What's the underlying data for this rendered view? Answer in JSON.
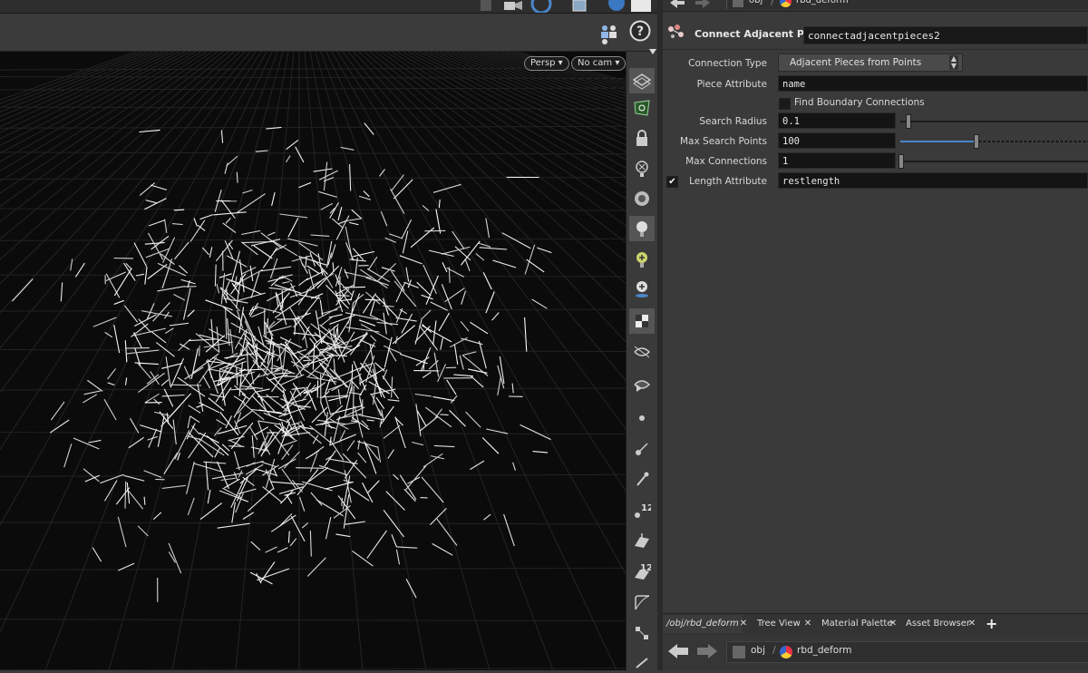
{
  "viewport": {
    "persp_label": "Persp",
    "cam_label": "No cam"
  },
  "top_path": {
    "obj": "obj",
    "node": "rbd_deform"
  },
  "node_header": {
    "type_label": "Connect Adjacent Pieces",
    "node_name": "connectadjacentpieces2"
  },
  "parameters": {
    "connection_type_label": "Connection Type",
    "connection_type_value": "Adjacent Pieces from Points",
    "piece_attribute_label": "Piece Attribute",
    "piece_attribute_value": "name",
    "find_boundary_label": "Find Boundary Connections",
    "find_boundary_checked": false,
    "search_radius_label": "Search Radius",
    "search_radius_value": "0.1",
    "max_search_points_label": "Max Search Points",
    "max_search_points_value": "100",
    "max_connections_label": "Max Connections",
    "max_connections_value": "1",
    "length_attribute_label": "Length Attribute",
    "length_attribute_value": "restlength",
    "length_attribute_enabled": true
  },
  "bottom_tabs": [
    {
      "label": "/obj/rbd_deform"
    },
    {
      "label": "Tree View"
    },
    {
      "label": "Material Palette"
    },
    {
      "label": "Asset Browser"
    }
  ],
  "bottom_path": {
    "obj": "obj",
    "node": "rbd_deform"
  },
  "shelf": {
    "badge_a": "12",
    "badge_b": "12"
  },
  "colors": {
    "viewport_bg": "#0b0b0b",
    "panel_bg": "#3a3a3a",
    "field_bg": "#141414",
    "accent_blue": "#4a86c8"
  }
}
